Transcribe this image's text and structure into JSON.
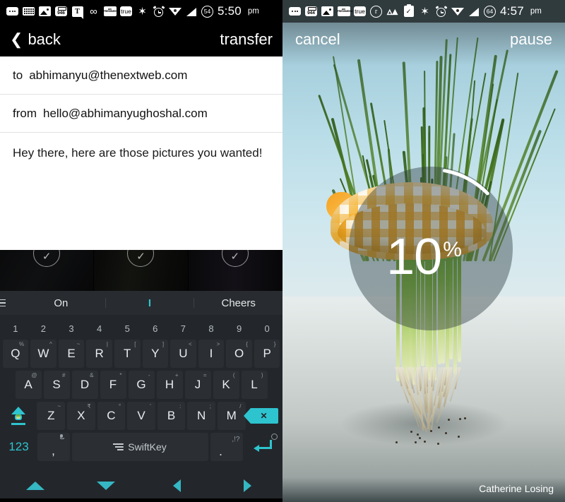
{
  "left_phone": {
    "statusbar": {
      "time": "5:50",
      "ampm": "pm",
      "battery": "54",
      "icons": [
        {
          "name": "messages-dots-icon",
          "label": "..."
        },
        {
          "name": "keyboard-icon",
          "label": "keyboard"
        },
        {
          "name": "photo-gallery-icon",
          "label": "image"
        },
        {
          "name": "camera-946-icon",
          "label": "946"
        },
        {
          "name": "tumblr-icon",
          "label": "T"
        },
        {
          "name": "infinity-icon",
          "label": "∞"
        },
        {
          "name": "freshnews-icon",
          "label": "am FRESHMENU"
        },
        {
          "name": "truecaller-icon",
          "label": "true"
        },
        {
          "name": "bluetooth-icon",
          "label": "bluetooth"
        },
        {
          "name": "alarm-icon",
          "label": "alarm"
        },
        {
          "name": "wifi-icon",
          "label": "wifi"
        },
        {
          "name": "signal-icon",
          "label": "signal"
        },
        {
          "name": "battery-icon",
          "label": "54"
        }
      ]
    },
    "appbar": {
      "back_label": "back",
      "action_label": "transfer"
    },
    "compose": {
      "to_label": "to",
      "to_value": "abhimanyu@thenextweb.com",
      "from_label": "from",
      "from_value": "hello@abhimanyughoshal.com",
      "body": "Hey there, here are those pictures you wanted!"
    },
    "photostrip": {
      "check_glyph": "⌄",
      "count": 3
    },
    "suggestions": {
      "menu_icon": "hamburger-menu-icon",
      "left": "On",
      "middle": "I",
      "right": "Cheers"
    },
    "keyboard": {
      "numbers": [
        "1",
        "2",
        "3",
        "4",
        "5",
        "6",
        "7",
        "8",
        "9",
        "0"
      ],
      "row1": [
        {
          "key": "Q",
          "sec": "%"
        },
        {
          "key": "W",
          "sec": "^"
        },
        {
          "key": "E",
          "sec": "~"
        },
        {
          "key": "R",
          "sec": "|"
        },
        {
          "key": "T",
          "sec": "["
        },
        {
          "key": "Y",
          "sec": "]"
        },
        {
          "key": "U",
          "sec": "<"
        },
        {
          "key": "I",
          "sec": ">"
        },
        {
          "key": "O",
          "sec": "{"
        },
        {
          "key": "P",
          "sec": "}"
        }
      ],
      "row2": [
        {
          "key": "A",
          "sec": "@"
        },
        {
          "key": "S",
          "sec": "#"
        },
        {
          "key": "D",
          "sec": "&"
        },
        {
          "key": "F",
          "sec": "*"
        },
        {
          "key": "G",
          "sec": "-"
        },
        {
          "key": "H",
          "sec": "+"
        },
        {
          "key": "J",
          "sec": "="
        },
        {
          "key": "K",
          "sec": "("
        },
        {
          "key": "L",
          "sec": ")"
        }
      ],
      "row3": [
        {
          "key": "Z",
          "sec": "~"
        },
        {
          "key": "X",
          "sec": "₹"
        },
        {
          "key": "C",
          "sec": "°"
        },
        {
          "key": "V",
          "sec": "'"
        },
        {
          "key": "B",
          "sec": ":"
        },
        {
          "key": "N",
          "sec": ";"
        },
        {
          "key": "M",
          "sec": "/"
        }
      ],
      "shift_icon": "shift-key-icon",
      "backspace_icon": "backspace-key-icon",
      "backspace_label": "✕",
      "numeric_label": "123",
      "comma_label": ",",
      "mic_icon": "microphone-icon",
      "space_label": "SwiftKey",
      "period_label": ".",
      "period_sec": ",!?",
      "enter_icon": "enter-key-icon",
      "emoji_icon": "smiley-icon"
    },
    "navbar": {
      "buttons": [
        {
          "name": "nav-arrow-up",
          "glyph": "up"
        },
        {
          "name": "nav-arrow-down",
          "glyph": "down"
        },
        {
          "name": "nav-arrow-left",
          "glyph": "left"
        },
        {
          "name": "nav-arrow-right",
          "glyph": "right"
        }
      ]
    },
    "colors": {
      "accent": "#2ec4cf",
      "keyboard_bg": "#23272b",
      "key_bg": "#2b2f34"
    }
  },
  "right_phone": {
    "statusbar": {
      "time": "4:57",
      "ampm": "pm",
      "battery": "64",
      "icons": [
        {
          "name": "messages-dots-icon",
          "label": "..."
        },
        {
          "name": "camera-944-icon",
          "label": "944"
        },
        {
          "name": "photo-gallery-icon",
          "label": "image"
        },
        {
          "name": "freshnews-icon",
          "label": "am FRESHMENU"
        },
        {
          "name": "truecaller-icon",
          "label": "true"
        },
        {
          "name": "reddit-icon",
          "label": "r"
        },
        {
          "name": "monument-icon",
          "label": "M"
        },
        {
          "name": "clipboard-check-icon",
          "label": "clipboard"
        },
        {
          "name": "bluetooth-icon",
          "label": "bluetooth"
        },
        {
          "name": "alarm-icon",
          "label": "alarm"
        },
        {
          "name": "wifi-icon",
          "label": "wifi"
        },
        {
          "name": "signal-icon",
          "label": "signal"
        },
        {
          "name": "battery-icon",
          "label": "64"
        }
      ]
    },
    "appbar": {
      "cancel_label": "cancel",
      "pause_label": "pause"
    },
    "progress": {
      "value": "10",
      "unit": "%",
      "percent": 10
    },
    "credit": "Catherine Losing",
    "colors": {
      "overlay": "rgba(40,55,60,0.42)",
      "arc": "#ffffff"
    }
  }
}
